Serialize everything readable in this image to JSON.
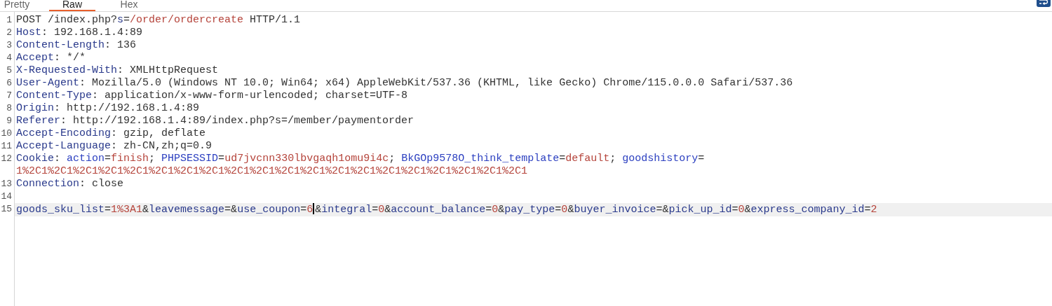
{
  "tabs": [
    {
      "label": "Pretty",
      "selected": false
    },
    {
      "label": "Raw",
      "selected": true
    },
    {
      "label": "Hex",
      "selected": false
    }
  ],
  "wrap_toggle": {
    "on": true
  },
  "editor": {
    "lines": [
      {
        "number": "1",
        "selected": false,
        "rows": [
          [
            {
              "kind": "plain",
              "text": "POST /index.php?"
            },
            {
              "kind": "name",
              "text": "s"
            },
            {
              "kind": "plain",
              "text": "="
            },
            {
              "kind": "value",
              "text": "/order/ordercreate"
            },
            {
              "kind": "plain",
              "text": " HTTP/1.1"
            }
          ]
        ]
      },
      {
        "number": "2",
        "selected": false,
        "rows": [
          [
            {
              "kind": "name",
              "text": "Host"
            },
            {
              "kind": "plain",
              "text": ": 192.168.1.4:89"
            }
          ]
        ]
      },
      {
        "number": "3",
        "selected": false,
        "rows": [
          [
            {
              "kind": "name",
              "text": "Content-Length"
            },
            {
              "kind": "plain",
              "text": ": 136"
            }
          ]
        ]
      },
      {
        "number": "4",
        "selected": false,
        "rows": [
          [
            {
              "kind": "name",
              "text": "Accept"
            },
            {
              "kind": "plain",
              "text": ": */*"
            }
          ]
        ]
      },
      {
        "number": "5",
        "selected": false,
        "rows": [
          [
            {
              "kind": "name",
              "text": "X-Requested-With"
            },
            {
              "kind": "plain",
              "text": ": XMLHttpRequest"
            }
          ]
        ]
      },
      {
        "number": "6",
        "selected": false,
        "rows": [
          [
            {
              "kind": "name",
              "text": "User-Agent"
            },
            {
              "kind": "plain",
              "text": ": Mozilla/5.0 (Windows NT 10.0; Win64; x64) AppleWebKit/537.36 (KHTML, like Gecko) Chrome/115.0.0.0 Safari/537.36"
            }
          ]
        ]
      },
      {
        "number": "7",
        "selected": false,
        "rows": [
          [
            {
              "kind": "name",
              "text": "Content-Type"
            },
            {
              "kind": "plain",
              "text": ": application/x-www-form-urlencoded; charset=UTF-8"
            }
          ]
        ]
      },
      {
        "number": "8",
        "selected": false,
        "rows": [
          [
            {
              "kind": "name",
              "text": "Origin"
            },
            {
              "kind": "plain",
              "text": ": http://192.168.1.4:89"
            }
          ]
        ]
      },
      {
        "number": "9",
        "selected": false,
        "rows": [
          [
            {
              "kind": "name",
              "text": "Referer"
            },
            {
              "kind": "plain",
              "text": ": http://192.168.1.4:89/index.php?s=/member/paymentorder"
            }
          ]
        ]
      },
      {
        "number": "10",
        "selected": false,
        "rows": [
          [
            {
              "kind": "name",
              "text": "Accept-Encoding"
            },
            {
              "kind": "plain",
              "text": ": gzip, deflate"
            }
          ]
        ]
      },
      {
        "number": "11",
        "selected": false,
        "rows": [
          [
            {
              "kind": "name",
              "text": "Accept-Language"
            },
            {
              "kind": "plain",
              "text": ": zh-CN,zh;q=0.9"
            }
          ]
        ]
      },
      {
        "number": "12",
        "selected": false,
        "rows": [
          [
            {
              "kind": "name",
              "text": "Cookie"
            },
            {
              "kind": "plain",
              "text": ": "
            },
            {
              "kind": "key",
              "text": "action"
            },
            {
              "kind": "plain",
              "text": "="
            },
            {
              "kind": "value",
              "text": "finish"
            },
            {
              "kind": "plain",
              "text": "; "
            },
            {
              "kind": "key",
              "text": "PHPSESSID"
            },
            {
              "kind": "plain",
              "text": "="
            },
            {
              "kind": "value",
              "text": "ud7jvcnn330lbvgaqh1omu9i4c"
            },
            {
              "kind": "plain",
              "text": "; "
            },
            {
              "kind": "key",
              "text": "BkGOp9578O_think_template"
            },
            {
              "kind": "plain",
              "text": "="
            },
            {
              "kind": "value",
              "text": "default"
            },
            {
              "kind": "plain",
              "text": "; "
            },
            {
              "kind": "key",
              "text": "goodshistory"
            },
            {
              "kind": "plain",
              "text": "="
            }
          ],
          [
            {
              "kind": "value",
              "text": "1%2C1%2C1%2C1%2C1%2C1%2C1%2C1%2C1%2C1%2C1%2C1%2C1%2C1%2C1%2C1%2C1%2C1%2C1%2C1%2C1"
            }
          ]
        ]
      },
      {
        "number": "13",
        "selected": false,
        "rows": [
          [
            {
              "kind": "name",
              "text": "Connection"
            },
            {
              "kind": "plain",
              "text": ": close"
            }
          ]
        ]
      },
      {
        "number": "14",
        "selected": false
      },
      {
        "number": "15",
        "selected": true,
        "rows": [
          [
            {
              "kind": "name",
              "text": "goods_sku_list"
            },
            {
              "kind": "plain",
              "text": "="
            },
            {
              "kind": "value",
              "text": "1%3A1"
            },
            {
              "kind": "plain",
              "text": "&"
            },
            {
              "kind": "name",
              "text": "leavemessage"
            },
            {
              "kind": "plain",
              "text": "=&"
            },
            {
              "kind": "name",
              "text": "use_coupon"
            },
            {
              "kind": "plain",
              "text": "="
            },
            {
              "kind": "value",
              "text": "6",
              "caret": true
            },
            {
              "kind": "plain",
              "text": "&"
            },
            {
              "kind": "name",
              "text": "integral"
            },
            {
              "kind": "plain",
              "text": "="
            },
            {
              "kind": "value",
              "text": "0"
            },
            {
              "kind": "plain",
              "text": "&"
            },
            {
              "kind": "name",
              "text": "account_balance"
            },
            {
              "kind": "plain",
              "text": "="
            },
            {
              "kind": "value",
              "text": "0"
            },
            {
              "kind": "plain",
              "text": "&"
            },
            {
              "kind": "name",
              "text": "pay_type"
            },
            {
              "kind": "plain",
              "text": "="
            },
            {
              "kind": "value",
              "text": "0"
            },
            {
              "kind": "plain",
              "text": "&"
            },
            {
              "kind": "name",
              "text": "buyer_invoice"
            },
            {
              "kind": "plain",
              "text": "=&"
            },
            {
              "kind": "name",
              "text": "pick_up_id"
            },
            {
              "kind": "plain",
              "text": "="
            },
            {
              "kind": "value",
              "text": "0"
            },
            {
              "kind": "plain",
              "text": "&"
            },
            {
              "kind": "name",
              "text": "express_company_id"
            },
            {
              "kind": "plain",
              "text": "="
            },
            {
              "kind": "value",
              "text": "2"
            }
          ]
        ]
      }
    ]
  }
}
